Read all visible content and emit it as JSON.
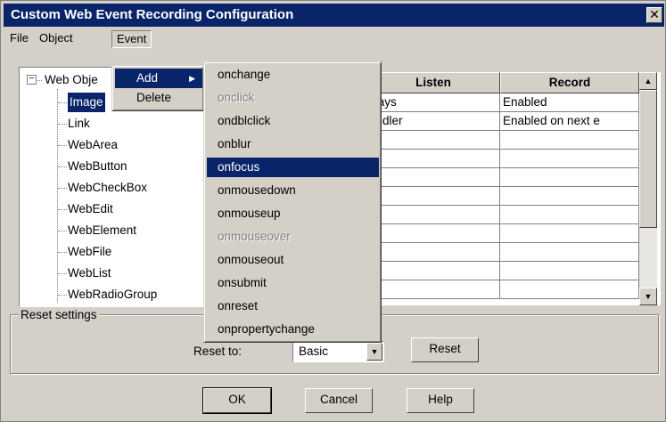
{
  "window": {
    "title": "Custom Web Event Recording Configuration",
    "close_glyph": "✕"
  },
  "menubar": {
    "items": [
      "File",
      "Object",
      "Event"
    ]
  },
  "tree": {
    "root_label": "Web Obje",
    "expander_glyph": "−",
    "children": [
      "Image",
      "Link",
      "WebArea",
      "WebButton",
      "WebCheckBox",
      "WebEdit",
      "WebElement",
      "WebFile",
      "WebList",
      "WebRadioGroup"
    ],
    "selected_index": 0
  },
  "grid": {
    "columns": [
      "Listen",
      "Record"
    ],
    "rows": [
      [
        "ways",
        "Enabled"
      ],
      [
        "andler",
        "Enabled on next e"
      ],
      [
        "",
        ""
      ],
      [
        "",
        ""
      ],
      [
        "",
        ""
      ],
      [
        "",
        ""
      ],
      [
        "",
        ""
      ],
      [
        "",
        ""
      ],
      [
        "",
        ""
      ],
      [
        "",
        ""
      ],
      [
        "",
        ""
      ]
    ]
  },
  "event_menu": {
    "items": [
      {
        "label": "Add",
        "has_submenu": true,
        "highlighted": true
      },
      {
        "label": "Delete",
        "has_submenu": false,
        "highlighted": false
      }
    ],
    "submenu_arrow": "▶"
  },
  "add_submenu": {
    "items": [
      {
        "label": "onchange",
        "disabled": false,
        "highlighted": false
      },
      {
        "label": "onclick",
        "disabled": true,
        "highlighted": false
      },
      {
        "label": "ondblclick",
        "disabled": false,
        "highlighted": false
      },
      {
        "label": "onblur",
        "disabled": false,
        "highlighted": false
      },
      {
        "label": "onfocus",
        "disabled": false,
        "highlighted": true
      },
      {
        "label": "onmousedown",
        "disabled": false,
        "highlighted": false
      },
      {
        "label": "onmouseup",
        "disabled": false,
        "highlighted": false
      },
      {
        "label": "onmouseover",
        "disabled": true,
        "highlighted": false
      },
      {
        "label": "onmouseout",
        "disabled": false,
        "highlighted": false
      },
      {
        "label": "onsubmit",
        "disabled": false,
        "highlighted": false
      },
      {
        "label": "onreset",
        "disabled": false,
        "highlighted": false
      },
      {
        "label": "onpropertychange",
        "disabled": false,
        "highlighted": false
      }
    ]
  },
  "reset_group": {
    "label": "Reset settings",
    "reset_to_label": "Reset to:",
    "reset_to_value": "Basic",
    "reset_button": "Reset"
  },
  "buttons": {
    "ok": "OK",
    "cancel": "Cancel",
    "help": "Help"
  },
  "icons": {
    "scroll_up": "▲",
    "scroll_down": "▼",
    "dropdown": "▼"
  },
  "colors": {
    "highlight": "#0a246a",
    "face": "#d4d0c8"
  }
}
